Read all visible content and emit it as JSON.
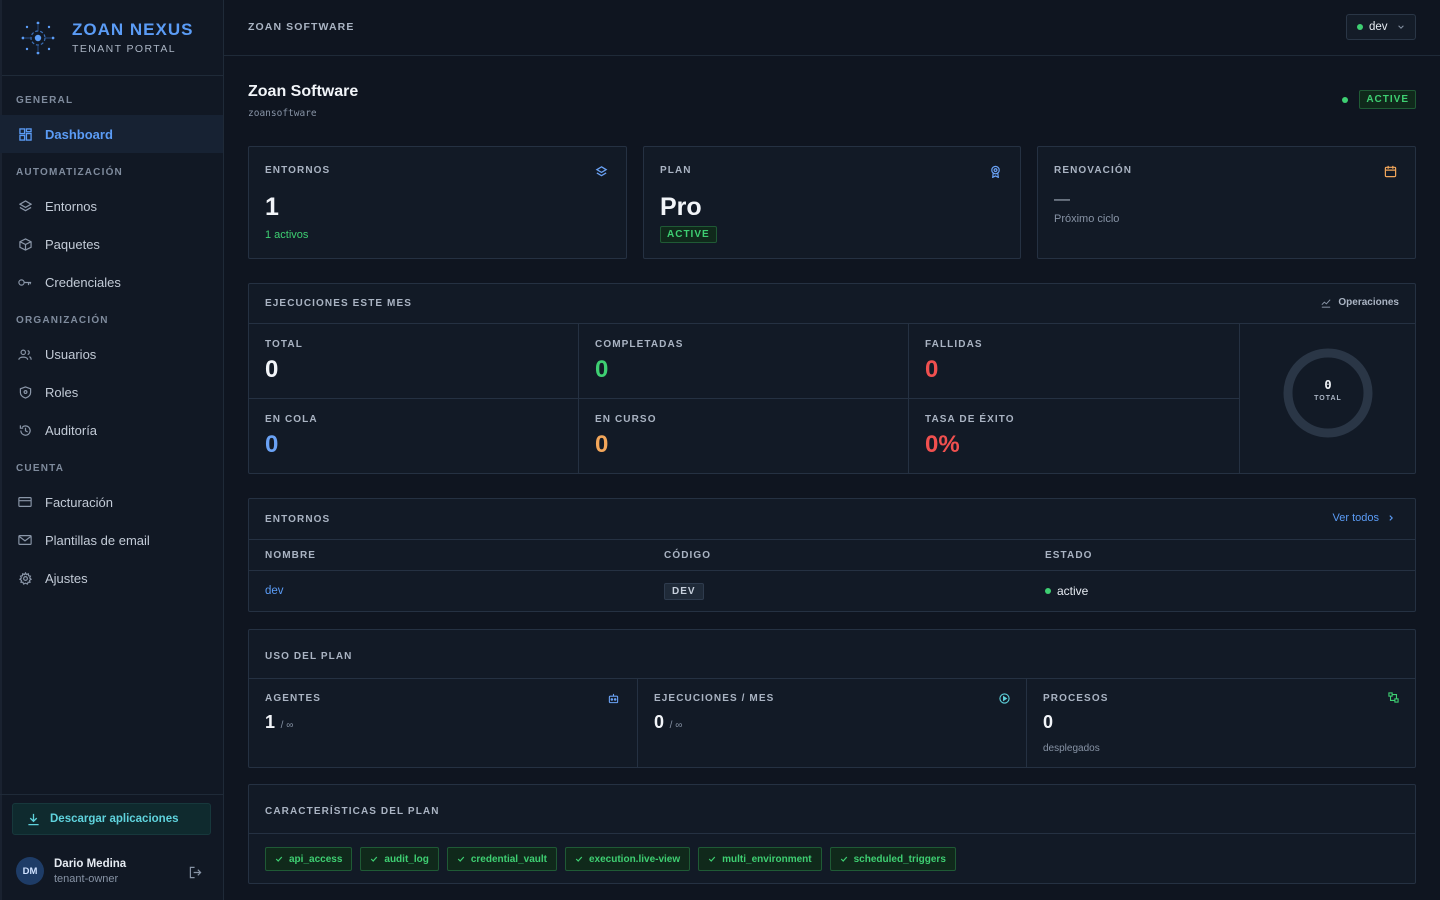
{
  "brand": {
    "title": "ZOAN NEXUS",
    "subtitle": "TENANT PORTAL"
  },
  "sidebar": {
    "sections": [
      {
        "label": "GENERAL",
        "items": [
          {
            "label": "Dashboard",
            "icon": "dashboard-icon",
            "active": true
          }
        ]
      },
      {
        "label": "AUTOMATIZACIÓN",
        "items": [
          {
            "label": "Entornos",
            "icon": "layers-icon"
          },
          {
            "label": "Paquetes",
            "icon": "package-icon"
          },
          {
            "label": "Credenciales",
            "icon": "key-icon"
          }
        ]
      },
      {
        "label": "ORGANIZACIÓN",
        "items": [
          {
            "label": "Usuarios",
            "icon": "users-icon"
          },
          {
            "label": "Roles",
            "icon": "shield-icon"
          },
          {
            "label": "Auditoría",
            "icon": "history-icon"
          }
        ]
      },
      {
        "label": "CUENTA",
        "items": [
          {
            "label": "Facturación",
            "icon": "card-icon"
          },
          {
            "label": "Plantillas de email",
            "icon": "mail-icon"
          },
          {
            "label": "Ajustes",
            "icon": "gear-icon"
          }
        ]
      }
    ],
    "download_label": "Descargar aplicaciones",
    "user": {
      "initials": "DM",
      "name": "Dario Medina",
      "role": "tenant-owner"
    }
  },
  "topbar": {
    "title": "ZOAN SOFTWARE",
    "env": "dev"
  },
  "tenant": {
    "name": "Zoan Software",
    "slug": "zoansoftware",
    "status": "ACTIVE"
  },
  "cards": {
    "environments": {
      "label": "ENTORNOS",
      "value": "1",
      "sub": "1 activos"
    },
    "plan": {
      "label": "PLAN",
      "value": "Pro",
      "status": "ACTIVE"
    },
    "renewal": {
      "label": "RENOVACIÓN",
      "value": "—",
      "sub": "Próximo ciclo"
    }
  },
  "executions": {
    "title": "EJECUCIONES ESTE MES",
    "link": "Operaciones",
    "total": {
      "label": "TOTAL",
      "value": "0"
    },
    "completed": {
      "label": "COMPLETADAS",
      "value": "0"
    },
    "failed": {
      "label": "FALLIDAS",
      "value": "0"
    },
    "queued": {
      "label": "EN COLA",
      "value": "0"
    },
    "running": {
      "label": "EN CURSO",
      "value": "0"
    },
    "success_rate": {
      "label": "TASA DE ÉXITO",
      "value": "0%"
    },
    "donut": {
      "value": "0",
      "label": "TOTAL"
    },
    "colors": {
      "completed": "#3ecf72",
      "failed": "#f0504f",
      "queued": "#6aa2f5",
      "running": "#f2a65a"
    }
  },
  "env_table": {
    "title": "ENTORNOS",
    "link": "Ver todos",
    "headers": [
      "NOMBRE",
      "CÓDIGO",
      "ESTADO"
    ],
    "rows": [
      {
        "name": "dev",
        "code": "DEV",
        "status": "active"
      }
    ]
  },
  "plan_usage": {
    "title": "USO DEL PLAN",
    "agents": {
      "label": "AGENTES",
      "value": "1",
      "limit": "/ ∞"
    },
    "executions": {
      "label": "EJECUCIONES / MES",
      "value": "0",
      "limit": "/ ∞"
    },
    "processes": {
      "label": "PROCESOS",
      "value": "0",
      "sub": "desplegados"
    }
  },
  "features": {
    "title": "CARACTERÍSTICAS DEL PLAN",
    "items": [
      "api_access",
      "audit_log",
      "credential_vault",
      "execution.live-view",
      "multi_environment",
      "scheduled_triggers"
    ]
  }
}
